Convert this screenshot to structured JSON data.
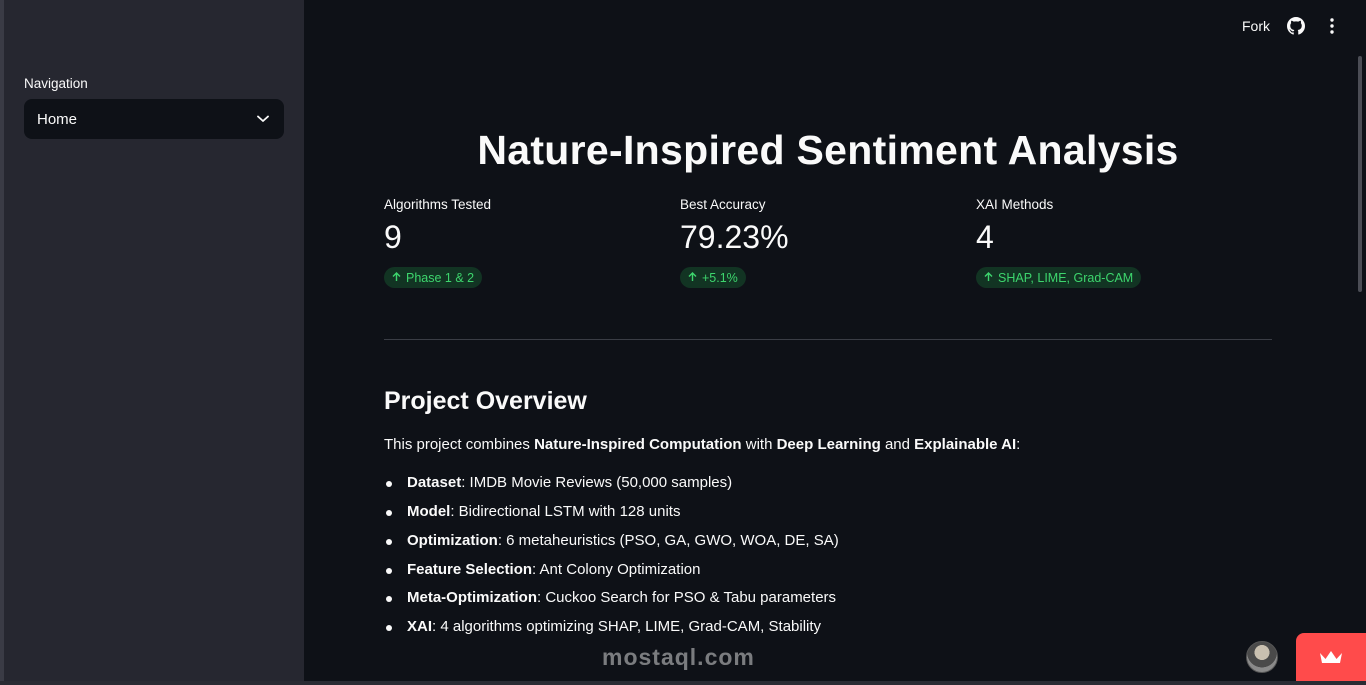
{
  "sidebar": {
    "nav_label": "Navigation",
    "selected": "Home"
  },
  "topbar": {
    "fork_label": "Fork",
    "github_icon": "github-icon",
    "menu_icon": "kebab-menu-icon"
  },
  "main": {
    "title": "Nature-Inspired Sentiment Analysis",
    "metrics": [
      {
        "label": "Algorithms Tested",
        "value": "9",
        "delta": "Phase 1 & 2"
      },
      {
        "label": "Best Accuracy",
        "value": "79.23%",
        "delta": "+5.1%"
      },
      {
        "label": "XAI Methods",
        "value": "4",
        "delta": "SHAP, LIME, Grad-CAM"
      }
    ],
    "overview_title": "Project Overview",
    "intro": {
      "prefix": "This project combines ",
      "b1": "Nature-Inspired Computation",
      "mid1": " with ",
      "b2": "Deep Learning",
      "mid2": " and ",
      "b3": "Explainable AI",
      "suffix": ":"
    },
    "features": [
      {
        "key": "Dataset",
        "text": ": IMDB Movie Reviews (50,000 samples)"
      },
      {
        "key": "Model",
        "text": ": Bidirectional LSTM with 128 units"
      },
      {
        "key": "Optimization",
        "text": ": 6 metaheuristics (PSO, GA, GWO, WOA, DE, SA)"
      },
      {
        "key": "Feature Selection",
        "text": ": Ant Colony Optimization"
      },
      {
        "key": "Meta-Optimization",
        "text": ": Cuckoo Search for PSO & Tabu parameters"
      },
      {
        "key": "XAI",
        "text": ": 4 algorithms optimizing SHAP, LIME, Grad-CAM, Stability"
      }
    ]
  },
  "watermark": "mostaql.com",
  "colors": {
    "background": "#0e1117",
    "sidebar": "#262730",
    "delta_text": "#3dd56d",
    "deploy": "#ff4b4b"
  }
}
